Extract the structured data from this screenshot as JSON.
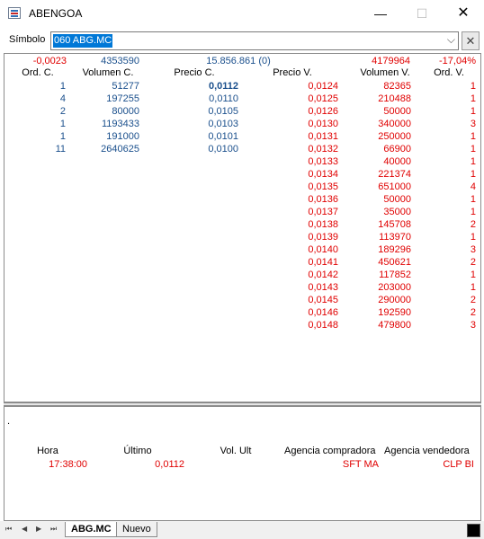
{
  "window": {
    "title": "ABENGOA",
    "minimize": "—",
    "maximize": "☐",
    "close": "✕"
  },
  "symbol": {
    "label": "Símbolo",
    "value": "060 ABG.MC",
    "caret": "⌵",
    "clear": "✕"
  },
  "summary": {
    "change": "-0,0023",
    "volume": "4353590",
    "turnover": "15.856.861 (0)",
    "volume_sell": "4179964",
    "pct": "-17,04%"
  },
  "headers": {
    "ord_c": "Ord. C.",
    "vol_c": "Volumen C.",
    "price_c": "Precio C.",
    "price_v": "Precio V.",
    "vol_v": "Volumen V.",
    "ord_v": "Ord. V."
  },
  "bids": [
    {
      "ord": "1",
      "vol": "51277",
      "price": "0,0112"
    },
    {
      "ord": "4",
      "vol": "197255",
      "price": "0,0110"
    },
    {
      "ord": "2",
      "vol": "80000",
      "price": "0,0105"
    },
    {
      "ord": "1",
      "vol": "1193433",
      "price": "0,0103"
    },
    {
      "ord": "1",
      "vol": "191000",
      "price": "0,0101"
    },
    {
      "ord": "11",
      "vol": "2640625",
      "price": "0,0100"
    }
  ],
  "asks": [
    {
      "price": "0,0124",
      "vol": "82365",
      "ord": "1"
    },
    {
      "price": "0,0125",
      "vol": "210488",
      "ord": "1"
    },
    {
      "price": "0,0126",
      "vol": "50000",
      "ord": "1"
    },
    {
      "price": "0,0130",
      "vol": "340000",
      "ord": "3"
    },
    {
      "price": "0,0131",
      "vol": "250000",
      "ord": "1"
    },
    {
      "price": "0,0132",
      "vol": "66900",
      "ord": "1"
    },
    {
      "price": "0,0133",
      "vol": "40000",
      "ord": "1"
    },
    {
      "price": "0,0134",
      "vol": "221374",
      "ord": "1"
    },
    {
      "price": "0,0135",
      "vol": "651000",
      "ord": "4"
    },
    {
      "price": "0,0136",
      "vol": "50000",
      "ord": "1"
    },
    {
      "price": "0,0137",
      "vol": "35000",
      "ord": "1"
    },
    {
      "price": "0,0138",
      "vol": "145708",
      "ord": "2"
    },
    {
      "price": "0,0139",
      "vol": "113970",
      "ord": "1"
    },
    {
      "price": "0,0140",
      "vol": "189296",
      "ord": "3"
    },
    {
      "price": "0,0141",
      "vol": "450621",
      "ord": "2"
    },
    {
      "price": "0,0142",
      "vol": "117852",
      "ord": "1"
    },
    {
      "price": "0,0143",
      "vol": "203000",
      "ord": "1"
    },
    {
      "price": "0,0145",
      "vol": "290000",
      "ord": "2"
    },
    {
      "price": "0,0146",
      "vol": "192590",
      "ord": "2"
    },
    {
      "price": "0,0148",
      "vol": "479800",
      "ord": "3"
    }
  ],
  "trades": {
    "dot": ".",
    "headers": {
      "time": "Hora",
      "last": "Último",
      "vol": "Vol. Ult",
      "buyer": "Agencia compradora",
      "seller": "Agencia vendedora"
    },
    "rows": [
      {
        "time": "17:38:00",
        "last": "0,0112",
        "vol": "",
        "buyer": "SFT MA",
        "seller": "CLP BI"
      }
    ]
  },
  "tabs": {
    "nav": [
      "⏮",
      "◀",
      "▶",
      "⏭"
    ],
    "items": [
      "ABG.MC",
      "Nuevo"
    ]
  },
  "colors": {
    "ask": "#e00000",
    "bid": "#1a4f8c",
    "selection": "#0078d7"
  }
}
